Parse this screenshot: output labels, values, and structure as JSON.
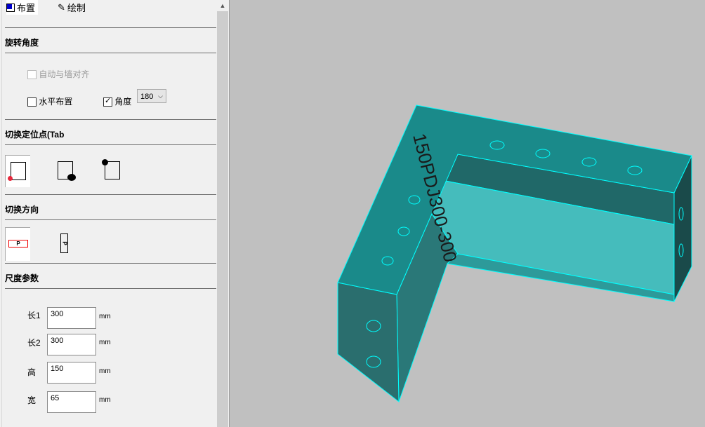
{
  "tabs": [
    {
      "label": "布置",
      "icon": "layout-icon"
    },
    {
      "label": "绘制",
      "icon": "pencil-icon"
    }
  ],
  "rotation": {
    "title": "旋转角度",
    "auto_align": "自动与墙对齐",
    "horizontal": "水平布置",
    "angle_label": "角度",
    "angle_value": "180",
    "angle_checked": true
  },
  "anchor": {
    "title": "切换定位点(Tab"
  },
  "direction": {
    "title": "切换方向",
    "p_label": "P"
  },
  "dims": {
    "title": "尺度参数",
    "fields": [
      {
        "label": "长1",
        "value": "300",
        "unit": "mm"
      },
      {
        "label": "长2",
        "value": "300",
        "unit": "mm"
      },
      {
        "label": "高",
        "value": "150",
        "unit": "mm"
      },
      {
        "label": "宽",
        "value": "65",
        "unit": "mm"
      }
    ]
  },
  "model": {
    "label": "150PDJ300-300",
    "top_color": "#1a8a8a",
    "floor_color": "#45bcbc",
    "edge_color": "#00ffff"
  }
}
